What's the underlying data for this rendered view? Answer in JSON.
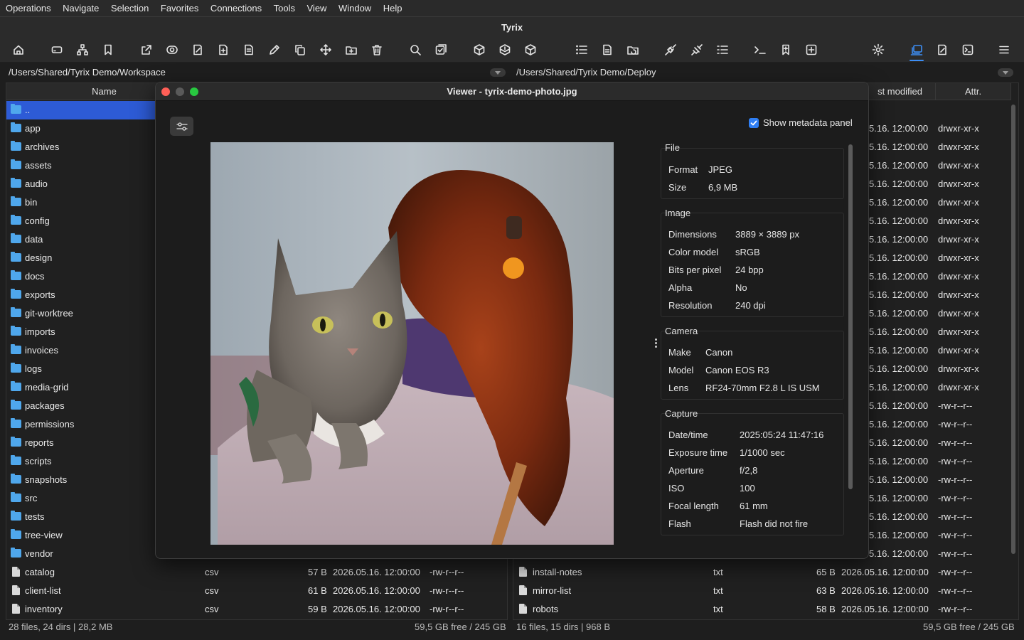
{
  "menu": [
    "Operations",
    "Navigate",
    "Selection",
    "Favorites",
    "Connections",
    "Tools",
    "View",
    "Window",
    "Help"
  ],
  "app_title": "Tyrix",
  "toolbar_icons": [
    "home-icon",
    "drive-icon",
    "network-icon",
    "bookmark-icon",
    "open-external-icon",
    "view-icon",
    "edit-icon",
    "new-file-icon",
    "file-text-icon",
    "rename-icon",
    "copy-icon",
    "move-icon",
    "new-folder-icon",
    "delete-icon",
    "search-icon",
    "compare-icon",
    "archive-icon",
    "extract-icon",
    "test-archive-icon",
    "list-view-icon",
    "properties-icon",
    "folder-sync-icon",
    "connect-icon",
    "disconnect-icon",
    "checklist-icon",
    "terminal-icon",
    "bookmark-add-icon",
    "new-tab-icon",
    "settings-icon",
    "dual-panel-icon",
    "editor-icon",
    "console-icon",
    "hamburger-icon"
  ],
  "left": {
    "path": "/Users/Shared/Tyrix Demo/Workspace",
    "col_name": "Name",
    "rows": [
      {
        "name": "..",
        "dir": true
      },
      {
        "name": "app",
        "dir": true
      },
      {
        "name": "archives",
        "dir": true
      },
      {
        "name": "assets",
        "dir": true
      },
      {
        "name": "audio",
        "dir": true
      },
      {
        "name": "bin",
        "dir": true
      },
      {
        "name": "config",
        "dir": true
      },
      {
        "name": "data",
        "dir": true
      },
      {
        "name": "design",
        "dir": true
      },
      {
        "name": "docs",
        "dir": true
      },
      {
        "name": "exports",
        "dir": true
      },
      {
        "name": "git-worktree",
        "dir": true
      },
      {
        "name": "imports",
        "dir": true
      },
      {
        "name": "invoices",
        "dir": true
      },
      {
        "name": "logs",
        "dir": true
      },
      {
        "name": "media-grid",
        "dir": true
      },
      {
        "name": "packages",
        "dir": true
      },
      {
        "name": "permissions",
        "dir": true
      },
      {
        "name": "reports",
        "dir": true
      },
      {
        "name": "scripts",
        "dir": true
      },
      {
        "name": "snapshots",
        "dir": true
      },
      {
        "name": "src",
        "dir": true
      },
      {
        "name": "tests",
        "dir": true
      },
      {
        "name": "tree-view",
        "dir": true
      },
      {
        "name": "vendor",
        "dir": true
      },
      {
        "name": "catalog",
        "dir": false,
        "ext": "csv",
        "size": "57 B",
        "date": "2026.05.16. 12:00:00",
        "attr": "-rw-r--r--"
      },
      {
        "name": "client-list",
        "dir": false,
        "ext": "csv",
        "size": "61 B",
        "date": "2026.05.16. 12:00:00",
        "attr": "-rw-r--r--"
      },
      {
        "name": "inventory",
        "dir": false,
        "ext": "csv",
        "size": "59 B",
        "date": "2026.05.16. 12:00:00",
        "attr": "-rw-r--r--"
      }
    ],
    "status_left": "28 files, 24 dirs | 28,2 MB",
    "status_right": "59,5 GB free / 245 GB"
  },
  "right": {
    "path": "/Users/Shared/Tyrix Demo/Deploy",
    "col_modified": "st modified",
    "col_attr": "Attr.",
    "partial_rows": [
      {
        "date": "5.16. 12:00:00",
        "attr": "drwxr-xr-x"
      },
      {
        "date": "5.16. 12:00:00",
        "attr": "drwxr-xr-x"
      },
      {
        "date": "5.16. 12:00:00",
        "attr": "drwxr-xr-x"
      },
      {
        "date": "5.16. 12:00:00",
        "attr": "drwxr-xr-x"
      },
      {
        "date": "5.16. 12:00:00",
        "attr": "drwxr-xr-x"
      },
      {
        "date": "5.16. 12:00:00",
        "attr": "drwxr-xr-x"
      },
      {
        "date": "5.16. 12:00:00",
        "attr": "drwxr-xr-x"
      },
      {
        "date": "5.16. 12:00:00",
        "attr": "drwxr-xr-x"
      },
      {
        "date": "5.16. 12:00:00",
        "attr": "drwxr-xr-x"
      },
      {
        "date": "5.16. 12:00:00",
        "attr": "drwxr-xr-x"
      },
      {
        "date": "5.16. 12:00:00",
        "attr": "drwxr-xr-x"
      },
      {
        "date": "5.16. 12:00:00",
        "attr": "drwxr-xr-x"
      },
      {
        "date": "5.16. 12:00:00",
        "attr": "drwxr-xr-x"
      },
      {
        "date": "5.16. 12:00:00",
        "attr": "drwxr-xr-x"
      },
      {
        "date": "5.16. 12:00:00",
        "attr": "drwxr-xr-x"
      },
      {
        "date": "5.16. 12:00:00",
        "attr": "-rw-r--r--"
      },
      {
        "date": "5.16. 12:00:00",
        "attr": "-rw-r--r--"
      },
      {
        "date": "5.16. 12:00:00",
        "attr": "-rw-r--r--"
      },
      {
        "date": "5.16. 12:00:00",
        "attr": "-rw-r--r--"
      },
      {
        "date": "5.16. 12:00:00",
        "attr": "-rw-r--r--"
      },
      {
        "date": "5.16. 12:00:00",
        "attr": "-rw-r--r--"
      },
      {
        "date": "5.16. 12:00:00",
        "attr": "-rw-r--r--"
      },
      {
        "date": "5.16. 12:00:00",
        "attr": "-rw-r--r--"
      },
      {
        "date": "5.16. 12:00:00",
        "attr": "-rw-r--r--"
      }
    ],
    "rows": [
      {
        "name": "install-notes",
        "ext": "txt",
        "size": "65 B",
        "date": "2026.05.16. 12:00:00",
        "attr": "-rw-r--r--"
      },
      {
        "name": "mirror-list",
        "ext": "txt",
        "size": "63 B",
        "date": "2026.05.16. 12:00:00",
        "attr": "-rw-r--r--"
      },
      {
        "name": "robots",
        "ext": "txt",
        "size": "58 B",
        "date": "2026.05.16. 12:00:00",
        "attr": "-rw-r--r--"
      }
    ],
    "status_left": "16 files, 15 dirs | 968 B",
    "status_right": "59,5 GB free / 245 GB"
  },
  "viewer": {
    "title": "Viewer - tyrix-demo-photo.jpg",
    "show_meta_label": "Show metadata panel",
    "show_meta_checked": true,
    "sections": [
      {
        "title": "File",
        "value_col": "narrow",
        "items": [
          [
            "Format",
            "JPEG"
          ],
          [
            "Size",
            "6,9 MB"
          ]
        ]
      },
      {
        "title": "Image",
        "value_col": "mid",
        "items": [
          [
            "Dimensions",
            "3889 × 3889 px"
          ],
          [
            "Color model",
            "sRGB"
          ],
          [
            "Bits per pixel",
            "24 bpp"
          ],
          [
            "Alpha",
            "No"
          ],
          [
            "Resolution",
            "240 dpi"
          ]
        ]
      },
      {
        "title": "Camera",
        "value_col": "narrow2",
        "items": [
          [
            "Make",
            "Canon"
          ],
          [
            "Model",
            "Canon EOS R3"
          ],
          [
            "Lens",
            "RF24-70mm F2.8 L IS USM"
          ]
        ]
      },
      {
        "title": "Capture",
        "value_col": "wide",
        "items": [
          [
            "Date/time",
            "2025:05:24 11:47:16"
          ],
          [
            "Exposure time",
            "1/1000 sec"
          ],
          [
            "Aperture",
            "f/2,8"
          ],
          [
            "ISO",
            "100"
          ],
          [
            "Focal length",
            "61 mm"
          ],
          [
            "Flash",
            "Flash did not fire"
          ]
        ]
      }
    ]
  },
  "colors": {
    "accent": "#3d8ef5",
    "selection": "#2d5bd6",
    "folder": "#4fa7ec",
    "close": "#ff5f57",
    "minimize": "#5a5a5a",
    "zoom": "#28c840"
  }
}
